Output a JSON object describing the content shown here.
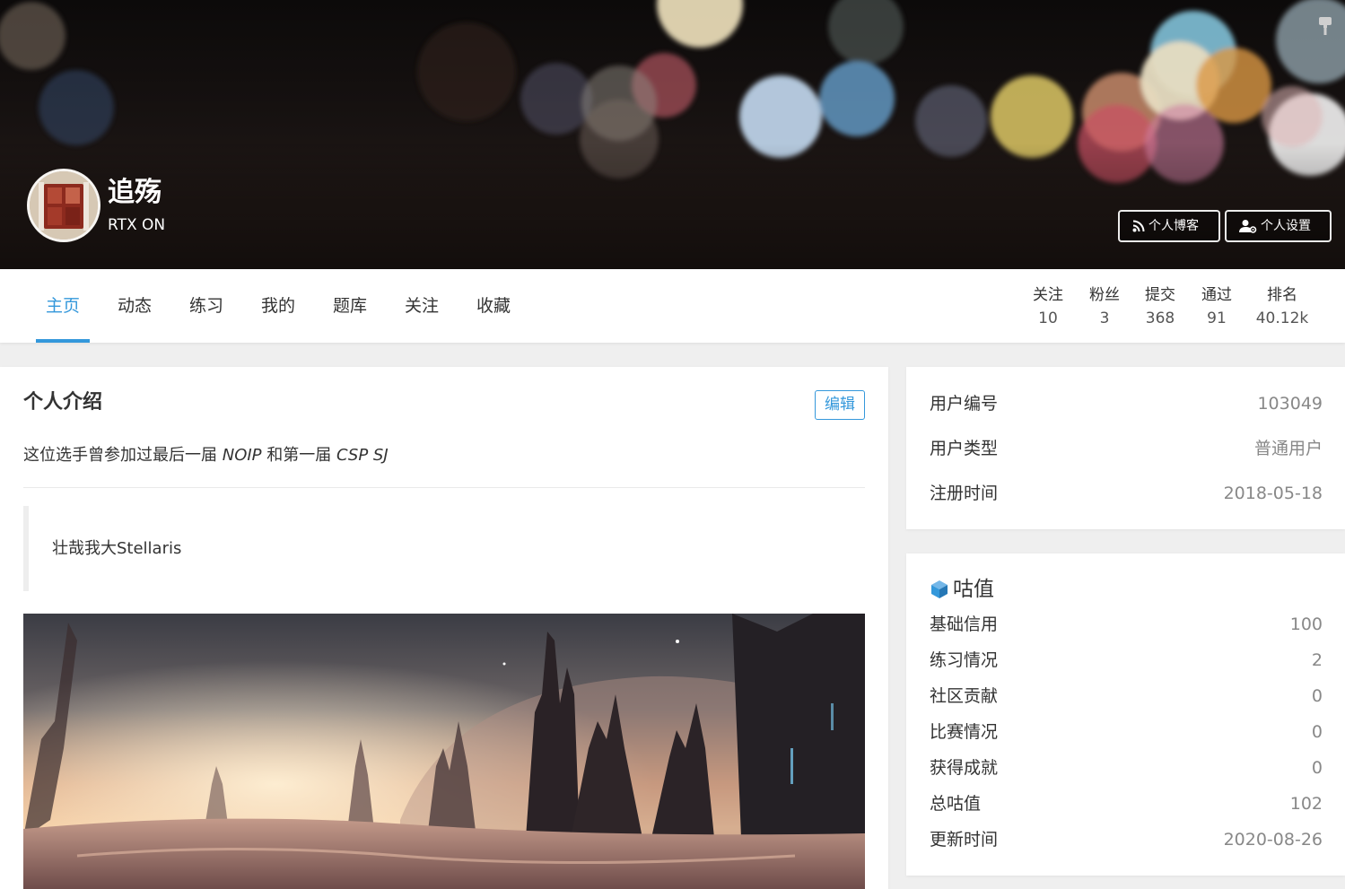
{
  "profile": {
    "name": "追殇",
    "slogan": "RTX ON"
  },
  "banner_buttons": {
    "blog": {
      "label": "个人博客",
      "icon": "rss-icon"
    },
    "settings": {
      "label": "个人设置",
      "icon": "user-gear-icon"
    }
  },
  "tabs": [
    {
      "label": "主页",
      "active": true
    },
    {
      "label": "动态"
    },
    {
      "label": "练习"
    },
    {
      "label": "我的"
    },
    {
      "label": "题库"
    },
    {
      "label": "关注"
    },
    {
      "label": "收藏"
    }
  ],
  "stats": [
    {
      "label": "关注",
      "value": "10"
    },
    {
      "label": "粉丝",
      "value": "3"
    },
    {
      "label": "提交",
      "value": "368"
    },
    {
      "label": "通过",
      "value": "91"
    },
    {
      "label": "排名",
      "value": "40.12k"
    }
  ],
  "intro": {
    "title": "个人介绍",
    "edit_label": "编辑",
    "text_before": "这位选手曾参加过最后一届 ",
    "term1": "NOIP",
    "text_middle": " 和第一届 ",
    "term2": "CSP SJ",
    "quote": "壮哉我大Stellaris"
  },
  "user_info": [
    {
      "label": "用户编号",
      "value": "103049"
    },
    {
      "label": "用户类型",
      "value": "普通用户"
    },
    {
      "label": "注册时间",
      "value": "2018-05-18"
    }
  ],
  "gu": {
    "title": "咕值",
    "icon": "cube-icon",
    "rows": [
      {
        "label": "基础信用",
        "value": "100"
      },
      {
        "label": "练习情况",
        "value": "2"
      },
      {
        "label": "社区贡献",
        "value": "0"
      },
      {
        "label": "比赛情况",
        "value": "0"
      },
      {
        "label": "获得成就",
        "value": "0"
      },
      {
        "label": "总咕值",
        "value": "102"
      },
      {
        "label": "更新时间",
        "value": "2020-08-26"
      }
    ]
  },
  "colors": {
    "accent": "#3498db",
    "text": "#333333",
    "muted": "#888888",
    "page_background": "#efefef"
  }
}
